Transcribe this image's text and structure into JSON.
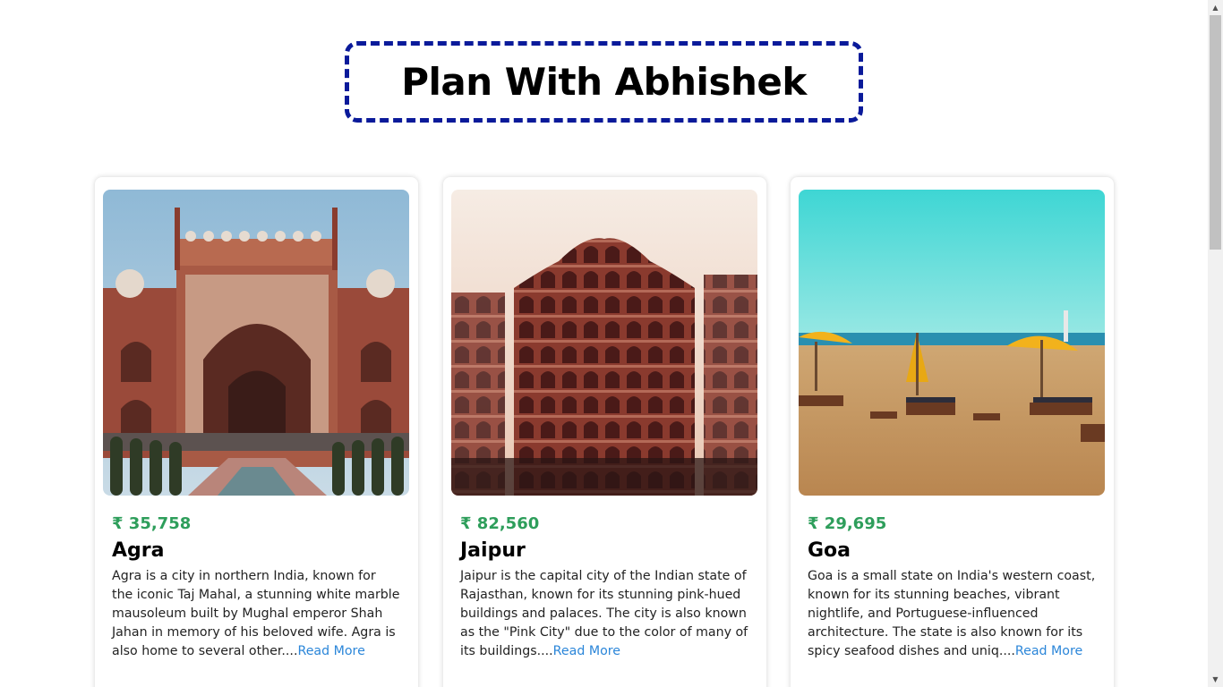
{
  "page": {
    "title": "Plan With Abhishek",
    "accent_color": "#0a1a9a",
    "price_color": "#2e9e5b",
    "link_color": "#2b86d9"
  },
  "cards": [
    {
      "image_icon": "taj-mahal-gate-photo",
      "price": "₹ 35,758",
      "city": "Agra",
      "description": "Agra is a city in northern India, known for the iconic Taj Mahal, a stunning white marble mausoleum built by Mughal emperor Shah Jahan in memory of his beloved wife. Agra is also home to several other....",
      "read_more": "Read More"
    },
    {
      "image_icon": "hawa-mahal-photo",
      "price": "₹ 82,560",
      "city": "Jaipur",
      "description": "Jaipur is the capital city of the Indian state of Rajasthan, known for its stunning pink-hued buildings and palaces. The city is also known as the \"Pink City\" due to the color of many of its buildings....",
      "read_more": "Read More"
    },
    {
      "image_icon": "goa-beach-photo",
      "price": "₹ 29,695",
      "city": "Goa",
      "description": "Goa is a small state on India's western coast, known for its stunning beaches, vibrant nightlife, and Portuguese-influenced architecture. The state is also known for its spicy seafood dishes and uniq....",
      "read_more": "Read More"
    }
  ]
}
